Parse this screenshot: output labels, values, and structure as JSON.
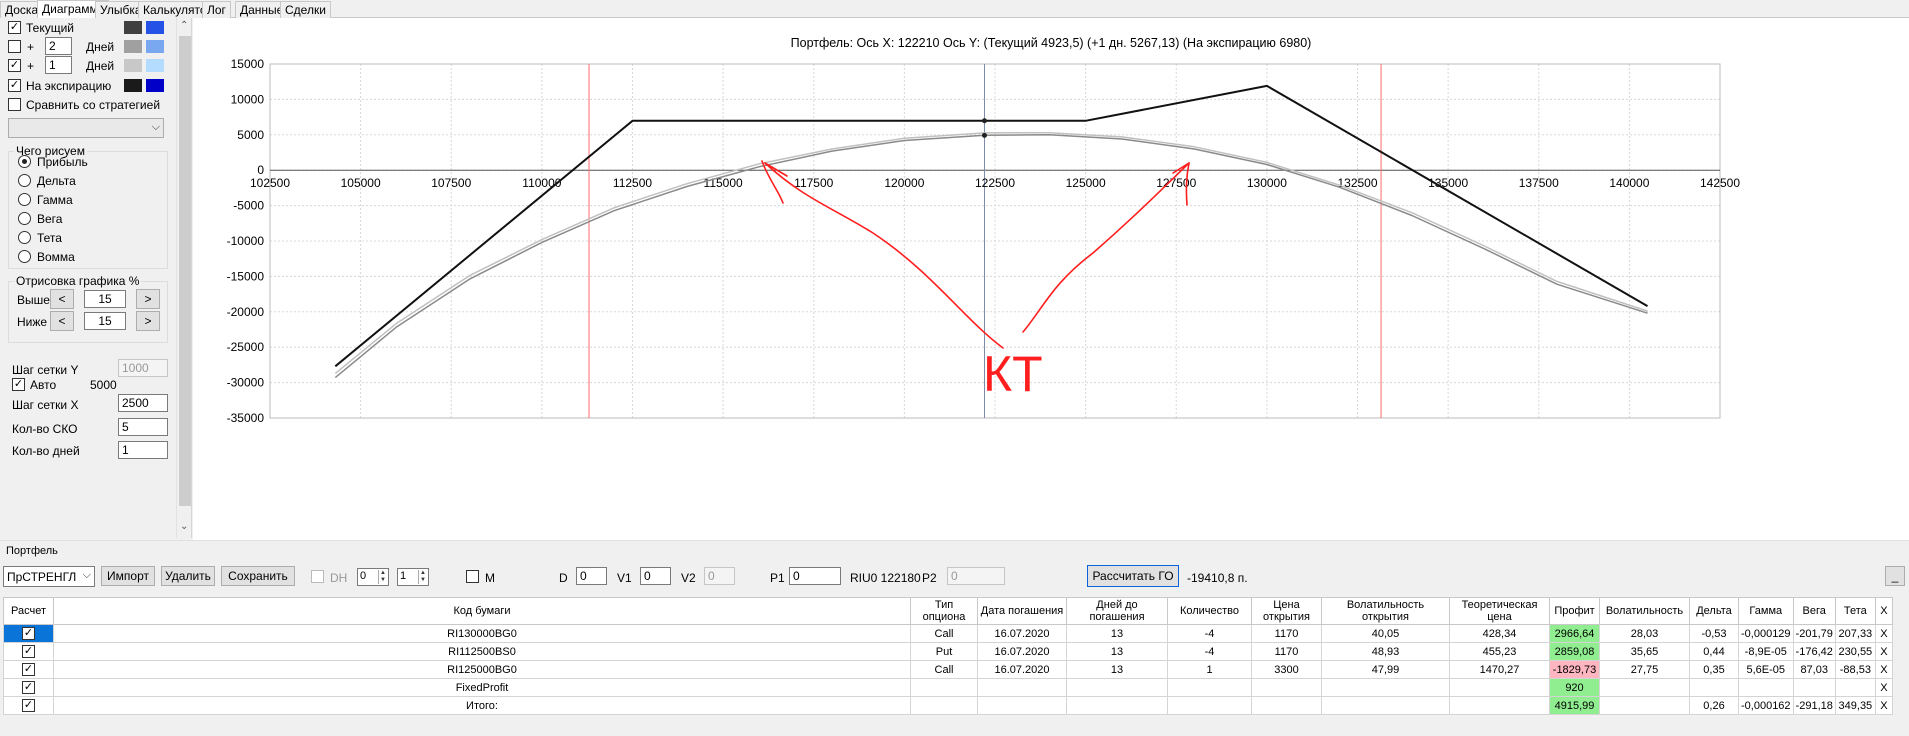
{
  "tabs": [
    "Доска",
    "Диаграмма",
    "Улыбка",
    "Калькулятор",
    "Лог",
    "Данные",
    "Сделки"
  ],
  "active_tab": "Диаграмма",
  "left": {
    "current_label": "Текущий",
    "plus": "+",
    "days_label": "Дней",
    "days1": "2",
    "days2": "1",
    "expiry_label": "На экспирацию",
    "compare_label": "Сравнить со стратегией",
    "draw_what_title": "Чего рисуем",
    "radios": [
      "Прибыль",
      "Дельта",
      "Гамма",
      "Вега",
      "Тета",
      "Вомма"
    ],
    "render_title": "Отрисовка графика %",
    "above_label": "Выше",
    "below_label": "Ниже",
    "above_value": "15",
    "below_value": "15",
    "lt": "<",
    "gt": ">",
    "grid_y_label": "Шаг сетки Y",
    "grid_y_value": "1000",
    "auto_label": "Авто",
    "auto_value": "5000",
    "grid_x_label": "Шаг сетки X",
    "grid_x_value": "2500",
    "sko_label": "Кол-во СКО",
    "sko_value": "5",
    "days_count_label": "Кол-во дней",
    "days_count_value": "1"
  },
  "colors": {
    "current_dark": "#404040",
    "current_light": "#2452e6",
    "plus2_dark": "#a0a0a0",
    "plus2_light": "#7aa8f0",
    "plus1_dark": "#c8c8c8",
    "plus1_light": "#b3dcff",
    "expiry_dark": "#1a1a1a",
    "expiry_light": "#0000c8"
  },
  "chart_title": "Портфель: Ось X: 122210 Ось Y:  (Текущий 4923,5)  (+1 дн. 5267,13)  (На экспирацию 6980)",
  "chart_data": {
    "type": "line",
    "xlim": [
      102500,
      142500
    ],
    "ylim": [
      -35000,
      15000
    ],
    "x_ticks": [
      102500,
      105000,
      107500,
      110000,
      112500,
      115000,
      117500,
      120000,
      122500,
      125000,
      127500,
      130000,
      132500,
      135000,
      137500,
      140000,
      142500
    ],
    "y_ticks": [
      15000,
      10000,
      5000,
      0,
      -5000,
      -10000,
      -15000,
      -20000,
      -25000,
      -30000,
      -35000
    ],
    "grid": true,
    "current_x": 122210,
    "vlines_red": [
      111300,
      133150
    ],
    "series": [
      {
        "color": "#111111",
        "x": [
          104300,
          112500,
          125000,
          130000,
          140500
        ],
        "y": [
          -27700,
          6980,
          6980,
          11900,
          -19200
        ]
      },
      {
        "color": "#8a8a8a",
        "x": [
          104300,
          106000,
          108000,
          110000,
          112000,
          114000,
          116000,
          118000,
          120000,
          122210,
          124000,
          126000,
          128000,
          130000,
          132000,
          134000,
          136000,
          138000,
          140500
        ],
        "y": [
          -29300,
          -22100,
          -15400,
          -10200,
          -5700,
          -2300,
          500,
          2700,
          4200,
          4923,
          5000,
          4400,
          3000,
          800,
          -2400,
          -6400,
          -11100,
          -16100,
          -20200
        ]
      },
      {
        "color": "#c0c0c0",
        "x": [
          104300,
          106000,
          108000,
          110000,
          112000,
          114000,
          116000,
          118000,
          120000,
          122210,
          124000,
          126000,
          128000,
          130000,
          132000,
          134000,
          136000,
          138000,
          140500
        ],
        "y": [
          -28700,
          -21600,
          -14900,
          -9800,
          -5300,
          -1900,
          900,
          3000,
          4500,
          5267,
          5300,
          4700,
          3300,
          1100,
          -2100,
          -6000,
          -10700,
          -15700,
          -19900
        ]
      }
    ],
    "markers": [
      {
        "x": 122210,
        "y": 6980
      },
      {
        "x": 122210,
        "y": 4923
      }
    ],
    "annotation_text": "КТ"
  },
  "portfolio": {
    "title": "Портфель",
    "strategy": "ПрСТРЕНГЛ",
    "import": "Импорт",
    "delete": "Удалить",
    "save": "Сохранить",
    "dh": "DH",
    "dh_spin1": "0",
    "dh_spin2": "1",
    "m_label": "M",
    "d_label": "D",
    "d_value": "0",
    "v1_label": "V1",
    "v1_value": "0",
    "v2_label": "V2",
    "v2_value": "0",
    "p1_label": "P1",
    "p1_value": "0",
    "riu": "RIU0 122180",
    "p2_label": "P2",
    "p2_value": "0",
    "calc_go": "Рассчитать ГО",
    "go_value": "-19410,8 п.",
    "underscore": "_"
  },
  "table": {
    "headers": [
      "Расчет",
      "Код бумаги",
      "Тип опциона",
      "Дата погашения",
      "Дней до погашения",
      "Количество",
      "Цена открытия",
      "Волатильность открытия",
      "Теоретическая цена",
      "Профит",
      "Волатильность",
      "Дельта",
      "Гамма",
      "Вега",
      "Тета",
      "X"
    ],
    "rows": [
      [
        "",
        "RI130000BG0",
        "Call",
        "16.07.2020",
        "13",
        "-4",
        "1170",
        "40,05",
        "428,34",
        "2966,64",
        "28,03",
        "-0,53",
        "-0,000129",
        "-201,79",
        "207,33",
        "X"
      ],
      [
        "",
        "RI112500BS0",
        "Put",
        "16.07.2020",
        "13",
        "-4",
        "1170",
        "48,93",
        "455,23",
        "2859,08",
        "35,65",
        "0,44",
        "-8,9E-05",
        "-176,42",
        "230,55",
        "X"
      ],
      [
        "",
        "RI125000BG0",
        "Call",
        "16.07.2020",
        "13",
        "1",
        "3300",
        "47,99",
        "1470,27",
        "-1829,73",
        "27,75",
        "0,35",
        "5,6E-05",
        "87,03",
        "-88,53",
        "X"
      ],
      [
        "",
        "FixedProfit",
        "",
        "",
        "",
        "",
        "",
        "",
        "",
        "920",
        "",
        "",
        "",
        "",
        "",
        "X"
      ],
      [
        "",
        "Итого:",
        "",
        "",
        "",
        "",
        "",
        "",
        "",
        "4915,99",
        "",
        "0,26",
        "-0,000162",
        "-291,18",
        "349,35",
        "X"
      ]
    ],
    "check_mark": "✓"
  }
}
